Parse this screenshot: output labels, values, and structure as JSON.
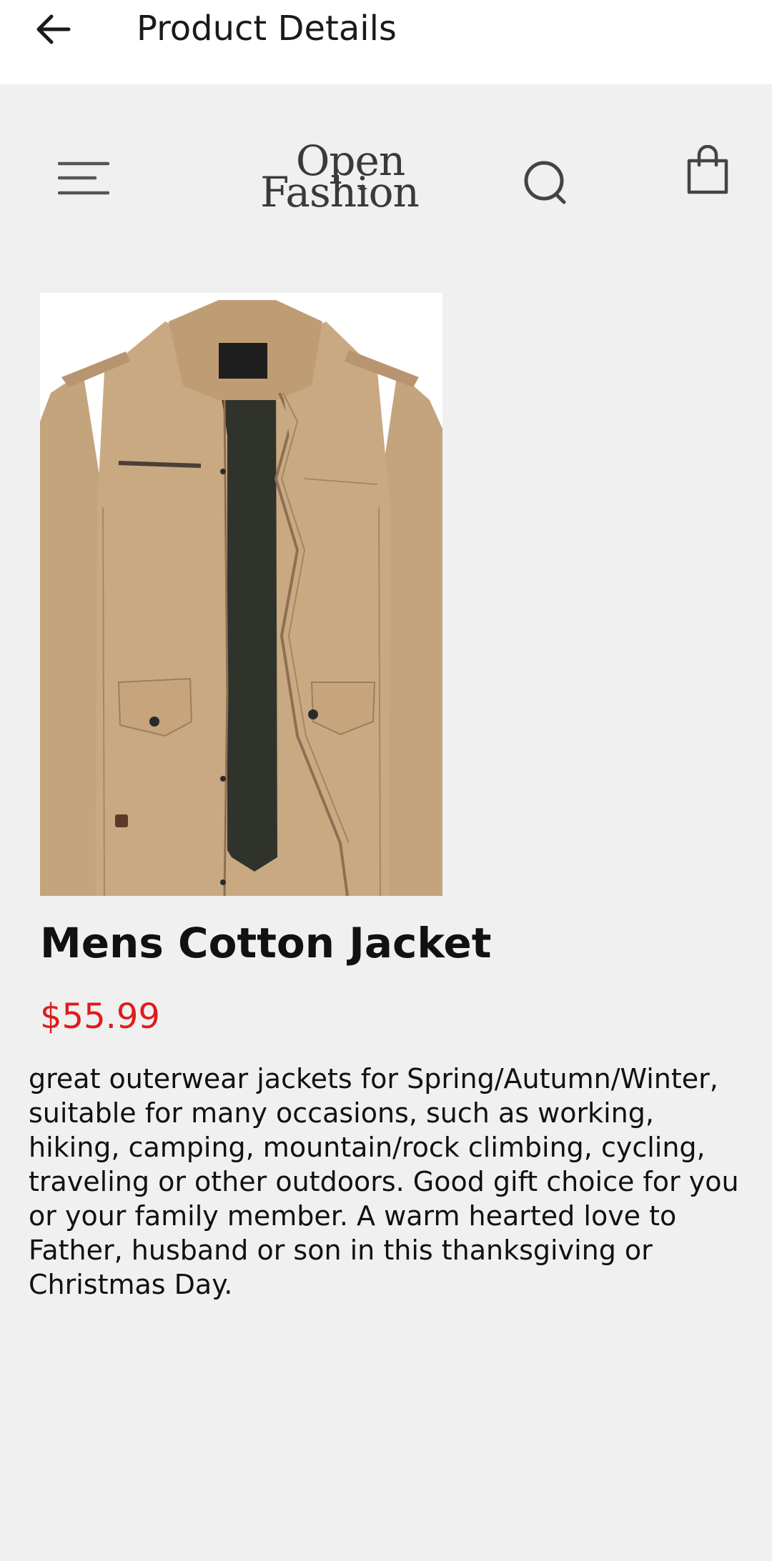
{
  "app_bar": {
    "title": "Product Details",
    "back_icon": "arrow-left-icon"
  },
  "store_header": {
    "menu_icon": "hamburger-menu-icon",
    "logo_line1": "Open",
    "logo_line2": "Fashion",
    "search_icon": "search-icon",
    "bag_icon": "shopping-bag-icon"
  },
  "product": {
    "image": "khaki-cotton-jacket",
    "name": "Mens Cotton Jacket",
    "price": "$55.99",
    "description": "great outerwear jackets for Spring/Autumn/Winter, suitable for many occasions, such as working, hiking, camping, mountain/rock climbing, cycling, traveling or other outdoors. Good gift choice for you or your family member. A warm hearted love to Father, husband or son in this thanksgiving or Christmas Day."
  },
  "colors": {
    "app_bar_bg": "#ffffff",
    "page_bg": "#f0f0f0",
    "price": "#e01b1b",
    "jacket": "#c9a982"
  }
}
